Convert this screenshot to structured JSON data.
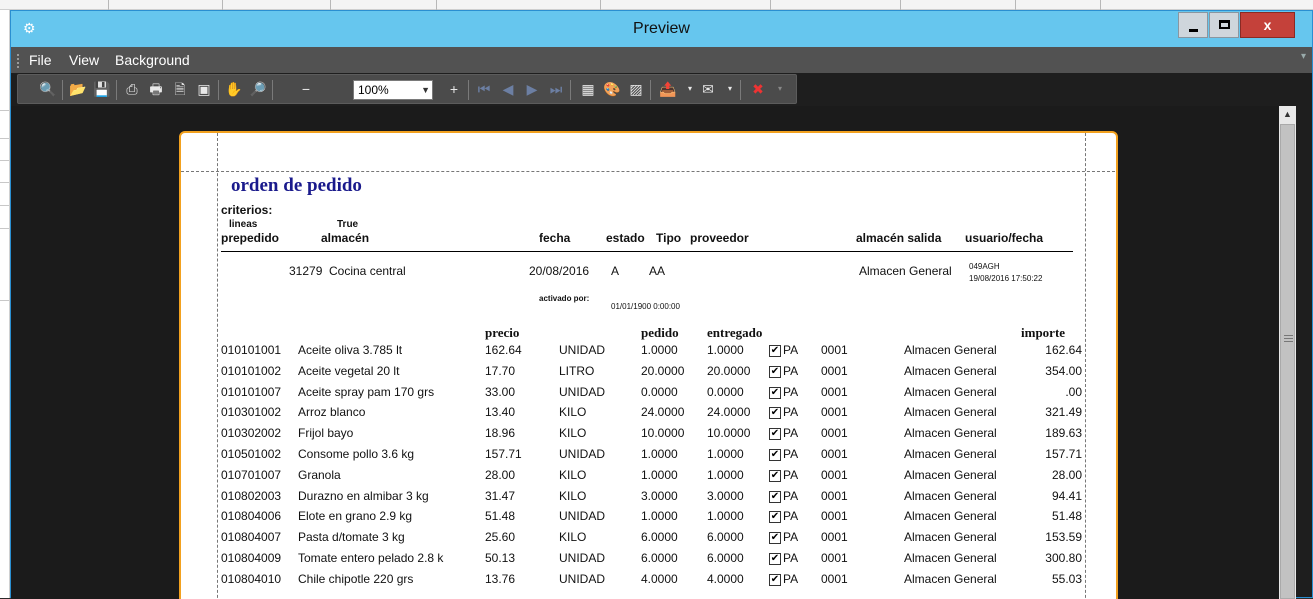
{
  "window": {
    "title": "Preview"
  },
  "menu": {
    "file": "File",
    "view": "View",
    "background": "Background"
  },
  "toolbar": {
    "zoom_value": "100%"
  },
  "report": {
    "title": "orden de pedido",
    "criteria_label": "criterios:",
    "lineas_label": "lineas",
    "true_value": "True",
    "headers": {
      "prepedido": "prepedido",
      "almacen": "almacén",
      "fecha": "fecha",
      "estado": "estado",
      "tipo": "Tipo",
      "proveedor": "proveedor",
      "almacen_salida": "almacén salida",
      "usuario_fecha": "usuario/fecha"
    },
    "order": {
      "id": "31279",
      "almacen": "Cocina central",
      "fecha": "20/08/2016",
      "estado": "A",
      "tipo": "AA",
      "almacen_salida": "Almacen General",
      "usuario": "049AGH",
      "usuario_fecha": "19/08/2016 17:50:22",
      "activado_label": "activado por:",
      "activado_fecha": "01/01/1900 0:00:00"
    },
    "item_headers": {
      "precio": "precio",
      "pedido": "pedido",
      "entregado": "entregado",
      "importe": "importe"
    },
    "items": [
      {
        "code": "010101001",
        "desc": "Aceite oliva 3.785 lt",
        "precio": "162.64",
        "unit": "UNIDAD",
        "pedido": "1.0000",
        "entregado": "1.0000",
        "checked": "✔",
        "pa": "PA",
        "num": "0001",
        "almacen": "Almacen General",
        "importe": "162.64"
      },
      {
        "code": "010101002",
        "desc": "Aceite vegetal 20 lt",
        "precio": "17.70",
        "unit": "LITRO",
        "pedido": "20.0000",
        "entregado": "20.0000",
        "checked": "✔",
        "pa": "PA",
        "num": "0001",
        "almacen": "Almacen General",
        "importe": "354.00"
      },
      {
        "code": "010101007",
        "desc": "Aceite spray pam 170 grs",
        "precio": "33.00",
        "unit": "UNIDAD",
        "pedido": "0.0000",
        "entregado": "0.0000",
        "checked": "✔",
        "pa": "PA",
        "num": "0001",
        "almacen": "Almacen General",
        "importe": ".00"
      },
      {
        "code": "010301002",
        "desc": "Arroz blanco",
        "precio": "13.40",
        "unit": "KILO",
        "pedido": "24.0000",
        "entregado": "24.0000",
        "checked": "✔",
        "pa": "PA",
        "num": "0001",
        "almacen": "Almacen General",
        "importe": "321.49"
      },
      {
        "code": "010302002",
        "desc": "Frijol bayo",
        "precio": "18.96",
        "unit": "KILO",
        "pedido": "10.0000",
        "entregado": "10.0000",
        "checked": "✔",
        "pa": "PA",
        "num": "0001",
        "almacen": "Almacen General",
        "importe": "189.63"
      },
      {
        "code": "010501002",
        "desc": "Consome pollo 3.6 kg",
        "precio": "157.71",
        "unit": "UNIDAD",
        "pedido": "1.0000",
        "entregado": "1.0000",
        "checked": "✔",
        "pa": "PA",
        "num": "0001",
        "almacen": "Almacen General",
        "importe": "157.71"
      },
      {
        "code": "010701007",
        "desc": "Granola",
        "precio": "28.00",
        "unit": "KILO",
        "pedido": "1.0000",
        "entregado": "1.0000",
        "checked": "✔",
        "pa": "PA",
        "num": "0001",
        "almacen": "Almacen General",
        "importe": "28.00"
      },
      {
        "code": "010802003",
        "desc": "Durazno en almibar 3 kg",
        "precio": "31.47",
        "unit": "KILO",
        "pedido": "3.0000",
        "entregado": "3.0000",
        "checked": "✔",
        "pa": "PA",
        "num": "0001",
        "almacen": "Almacen General",
        "importe": "94.41"
      },
      {
        "code": "010804006",
        "desc": "Elote en grano 2.9 kg",
        "precio": "51.48",
        "unit": "UNIDAD",
        "pedido": "1.0000",
        "entregado": "1.0000",
        "checked": "✔",
        "pa": "PA",
        "num": "0001",
        "almacen": "Almacen General",
        "importe": "51.48"
      },
      {
        "code": "010804007",
        "desc": "Pasta d/tomate 3 kg",
        "precio": "25.60",
        "unit": "KILO",
        "pedido": "6.0000",
        "entregado": "6.0000",
        "checked": "✔",
        "pa": "PA",
        "num": "0001",
        "almacen": "Almacen General",
        "importe": "153.59"
      },
      {
        "code": "010804009",
        "desc": "Tomate entero pelado 2.8 k",
        "precio": "50.13",
        "unit": "UNIDAD",
        "pedido": "6.0000",
        "entregado": "6.0000",
        "checked": "✔",
        "pa": "PA",
        "num": "0001",
        "almacen": "Almacen General",
        "importe": "300.80"
      },
      {
        "code": "010804010",
        "desc": "Chile chipotle 220 grs",
        "precio": "13.76",
        "unit": "UNIDAD",
        "pedido": "4.0000",
        "entregado": "4.0000",
        "checked": "✔",
        "pa": "PA",
        "num": "0001",
        "almacen": "Almacen General",
        "importe": "55.03"
      }
    ]
  }
}
